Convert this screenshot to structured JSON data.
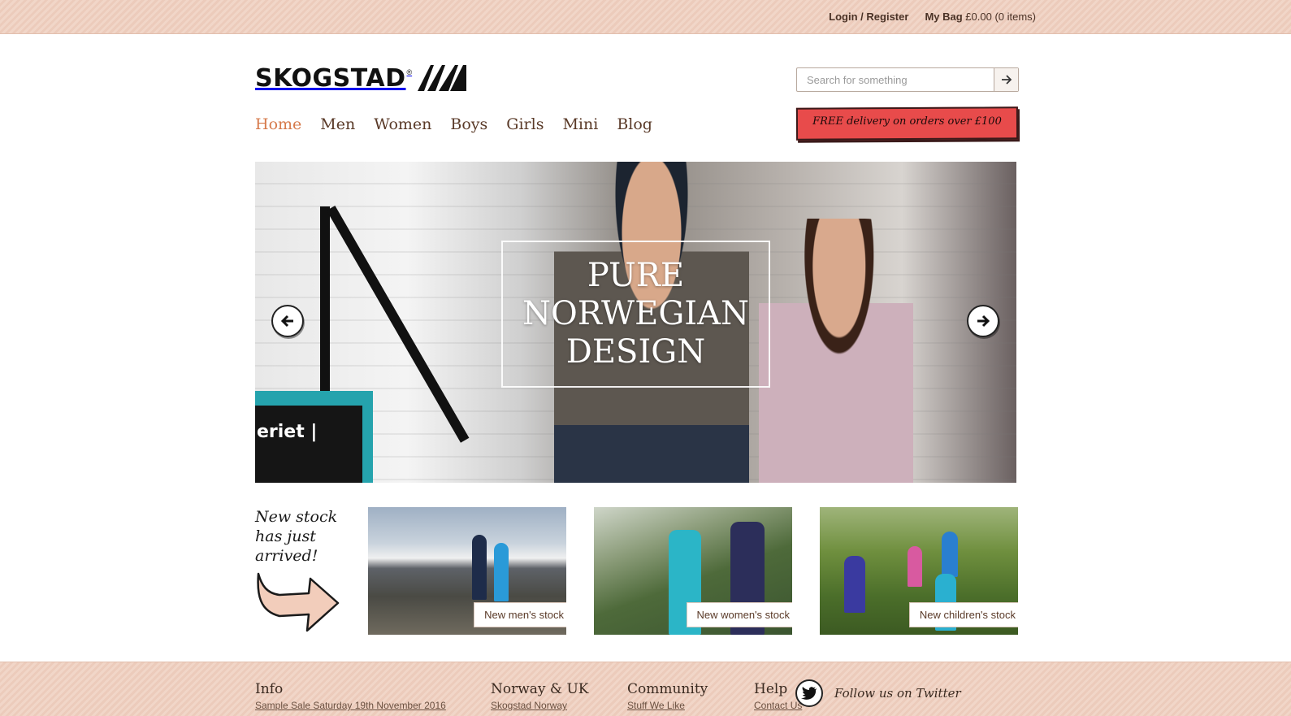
{
  "topbar": {
    "login": "Login",
    "separator": " / ",
    "register": "Register",
    "bag_label": "My Bag",
    "bag_value": "£0.00 (0 items)"
  },
  "logo": {
    "text": "SKOGSTAD",
    "reg": "®"
  },
  "search": {
    "placeholder": "Search for something",
    "button_icon": "arrow-right-icon"
  },
  "nav": {
    "items": [
      {
        "label": "Home",
        "active": true
      },
      {
        "label": "Men"
      },
      {
        "label": "Women"
      },
      {
        "label": "Boys"
      },
      {
        "label": "Girls"
      },
      {
        "label": "Mini"
      },
      {
        "label": "Blog"
      }
    ]
  },
  "promo": {
    "delivery": "FREE delivery on orders over £100",
    "color": "#e84b4b"
  },
  "hero": {
    "title": "PURE\nNORWEGIAN\nDESIGN",
    "sign_text": "eriet |",
    "prev_icon": "arrow-left-icon",
    "next_icon": "arrow-right-icon"
  },
  "new_stock": {
    "text": "New stock\nhas just\narrived!",
    "tiles": [
      {
        "label": "New men's stock"
      },
      {
        "label": "New women's stock"
      },
      {
        "label": "New children's stock"
      }
    ]
  },
  "footer": {
    "columns": [
      {
        "title": "Info",
        "sub": "Sample Sale Saturday 19th November 2016"
      },
      {
        "title": "Norway & UK",
        "sub": "Skogstad Norway"
      },
      {
        "title": "Community",
        "sub": "Stuff We Like"
      },
      {
        "title": "Help",
        "sub": "Contact Us"
      }
    ],
    "twitter": "Follow us on Twitter"
  },
  "colors": {
    "accent": "#d67a4b",
    "nav_text": "#5a3a28",
    "topbar_bg": "#f1d6c8"
  }
}
